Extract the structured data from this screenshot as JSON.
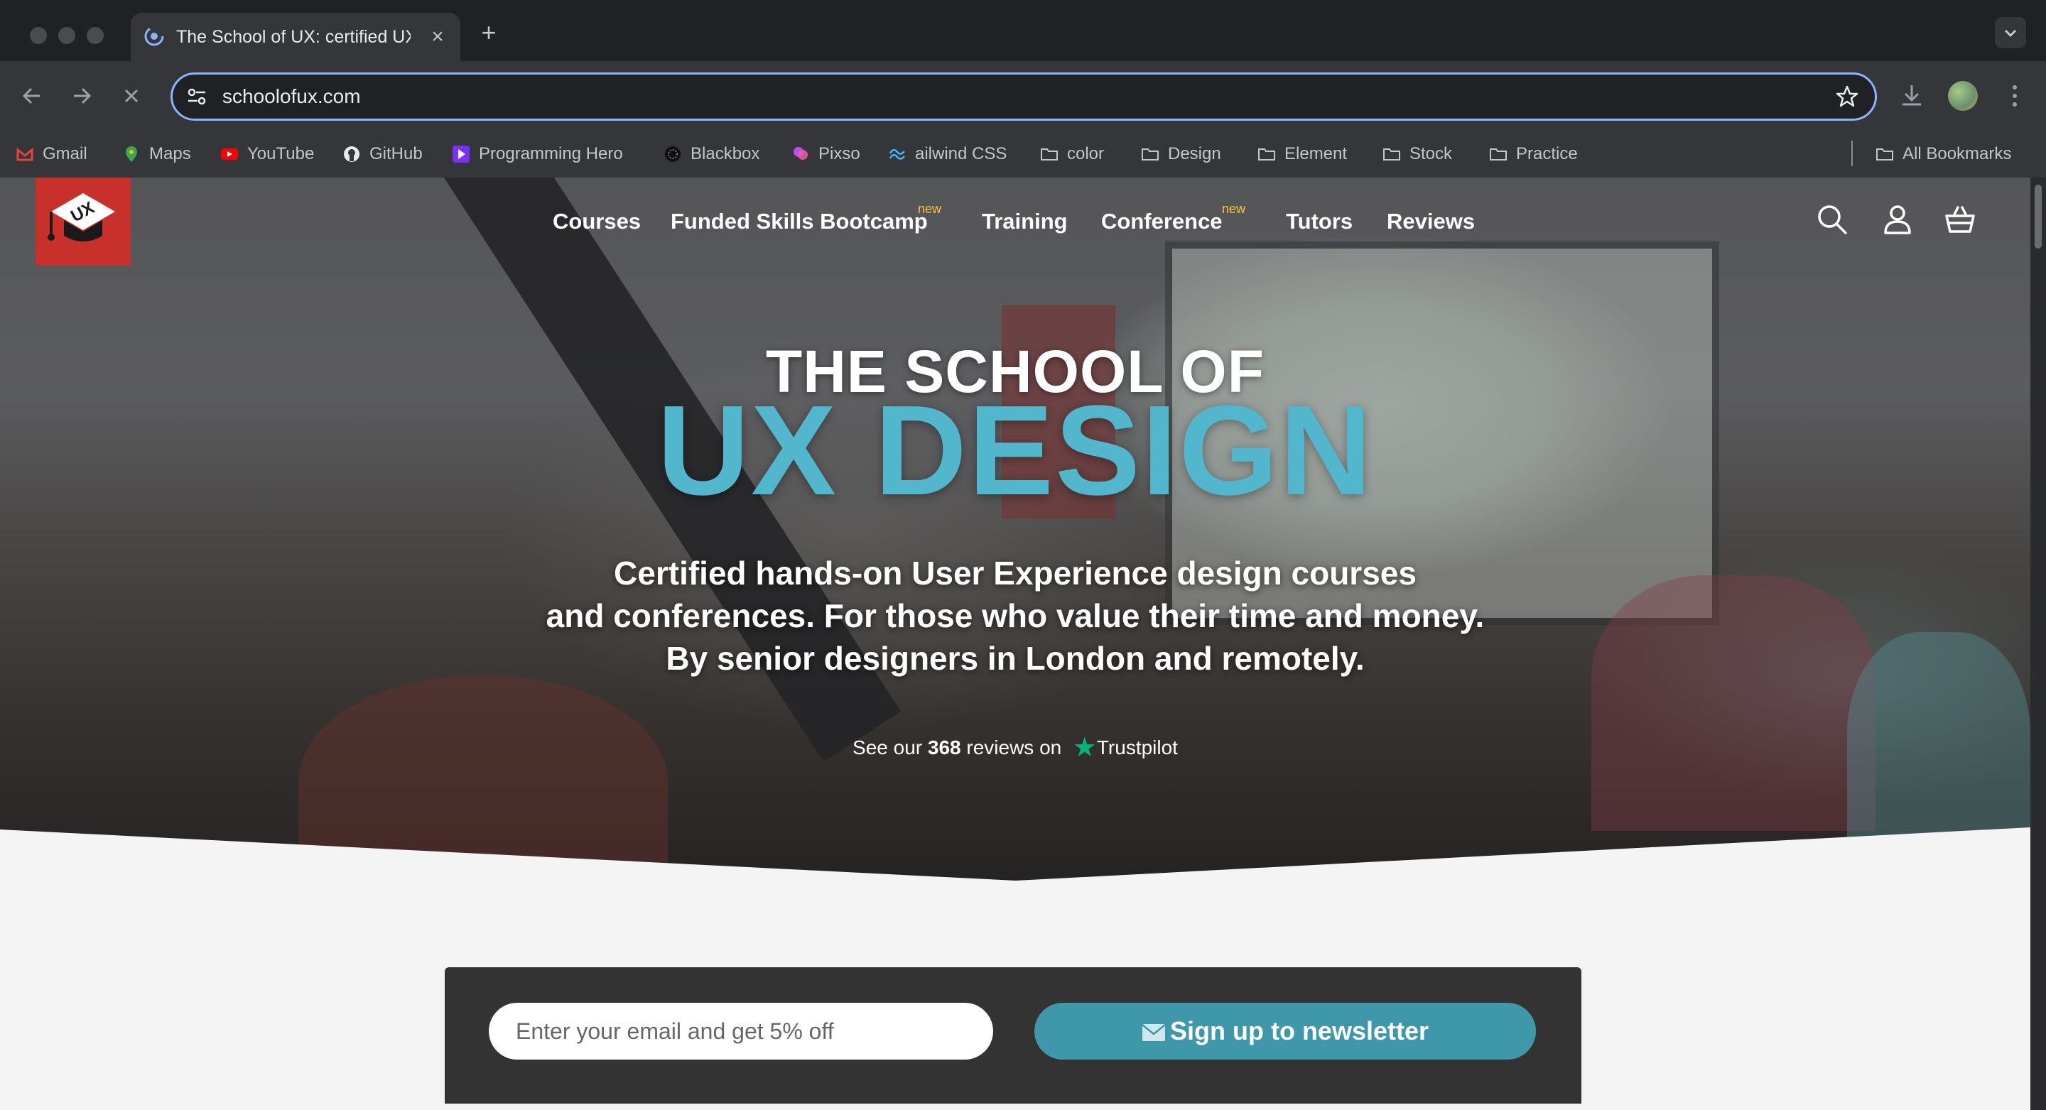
{
  "browser": {
    "tab_title": "The School of UX: certified UX design courses",
    "new_tab_symbol": "+",
    "close_symbol": "×",
    "url": "schoolofux.com",
    "bookmarks": [
      {
        "label": "Gmail",
        "icon": "gmail-icon"
      },
      {
        "label": "Maps",
        "icon": "maps-icon"
      },
      {
        "label": "YouTube",
        "icon": "youtube-icon"
      },
      {
        "label": "GitHub",
        "icon": "github-icon"
      },
      {
        "label": "Programming Hero",
        "icon": "programming-hero-icon"
      },
      {
        "label": "Blackbox",
        "icon": "blackbox-icon"
      },
      {
        "label": "Pixso",
        "icon": "pixso-icon"
      },
      {
        "label": "ailwind CSS",
        "icon": "tailwind-icon"
      },
      {
        "label": "color",
        "icon": "folder-icon"
      },
      {
        "label": "Design",
        "icon": "folder-icon"
      },
      {
        "label": "Element",
        "icon": "folder-icon"
      },
      {
        "label": "Stock",
        "icon": "folder-icon"
      },
      {
        "label": "Practice",
        "icon": "folder-icon"
      }
    ],
    "all_bookmarks": "All Bookmarks",
    "accent_color": "#8ab4f8"
  },
  "site": {
    "logo_text": "UX",
    "nav": [
      {
        "label": "Courses"
      },
      {
        "label": "Funded Skills Bootcamp",
        "badge": "new"
      },
      {
        "label": "Training"
      },
      {
        "label": "Conference",
        "badge": "new"
      },
      {
        "label": "Tutors"
      },
      {
        "label": "Reviews"
      }
    ],
    "hero": {
      "title_small": "THE SCHOOL OF",
      "title_big": "UX DESIGN",
      "subtitle_lines": [
        "Certified hands-on User Experience design courses",
        "and conferences. For those who value their time and money.",
        "By senior designers in London and remotely."
      ],
      "trust_prefix": "See our",
      "trust_count": "368",
      "trust_suffix": "reviews on",
      "trust_brand": "Trustpilot"
    },
    "newsletter": {
      "email_placeholder": "Enter your email and get 5% off",
      "button_label": "Sign up to newsletter"
    },
    "colors": {
      "brand_red": "#c8302b",
      "title_blue": "#52b6cc",
      "button_teal": "#3f98aa",
      "trustpilot_green": "#00b67a"
    }
  }
}
